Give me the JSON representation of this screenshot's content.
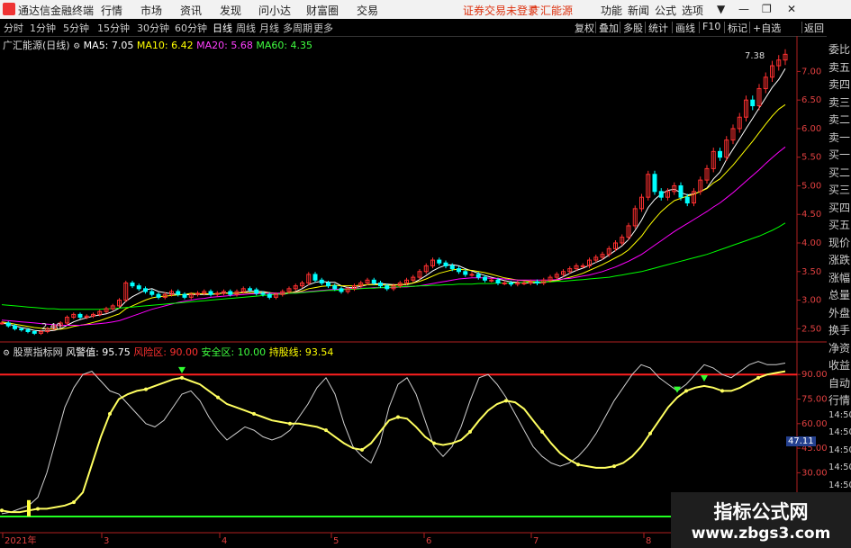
{
  "app": {
    "title": "通达信金融终端",
    "menu": [
      "行情",
      "市场",
      "资讯",
      "发现",
      "问小达",
      "财富圈",
      "交易"
    ],
    "notice": "证券交易未登录",
    "stock_name": "广汇能源",
    "right_menu": [
      "功能",
      "新闻",
      "公式",
      "选项"
    ],
    "window_controls": [
      "▼",
      "—",
      "❐",
      "✕"
    ]
  },
  "periods": {
    "items": [
      "分时",
      "1分钟",
      "5分钟",
      "15分钟",
      "30分钟",
      "60分钟",
      "日线",
      "周线",
      "月线",
      "多周期",
      "更多"
    ],
    "selected": "日线",
    "right_buttons": [
      "复权",
      "叠加",
      "多股",
      "统计",
      "画线",
      "F10",
      "标记",
      "+自选",
      "返回"
    ]
  },
  "main_legend": {
    "name": "广汇能源(日线)",
    "ma5": "MA5: 7.05",
    "ma10": "MA10: 6.42",
    "ma20": "MA20: 5.68",
    "ma60": "MA60: 4.35"
  },
  "indicator_legend": {
    "name": "股票指标网",
    "risk_value": "风警值: 95.75",
    "risk_zone": "风险区: 90.00",
    "safe_zone": "安全区: 10.00",
    "hold_line": "持股线: 93.54"
  },
  "price_axis": [
    "7.00",
    "6.50",
    "6.00",
    "5.50",
    "5.00",
    "4.50",
    "4.00",
    "3.50",
    "3.00",
    "2.50"
  ],
  "indicator_axis": [
    "90.00",
    "75.00",
    "60.00",
    "45.00",
    "30.00"
  ],
  "indicator_current": "47.11",
  "price_annotations": {
    "high": "7.38",
    "low": "2.40"
  },
  "x_axis": [
    "2021年",
    "3",
    "4",
    "5",
    "6",
    "7",
    "8"
  ],
  "right_panel": [
    "委比",
    "卖五",
    "卖四",
    "卖三",
    "卖二",
    "卖一",
    "买一",
    "买二",
    "买三",
    "买四",
    "买五",
    "现价",
    "涨跌",
    "涨幅",
    "总量",
    "外盘",
    "换手",
    "净资",
    "收益",
    "自动",
    "行情",
    "14:50",
    "14:50",
    "14:50",
    "14:50",
    "14:50",
    "14:50",
    "14:50",
    "14:50"
  ],
  "colors": {
    "ma5": "#ffffff",
    "ma10": "#ffff00",
    "ma20": "#ff00ff",
    "ma60": "#00ff00",
    "up": "#ff3030",
    "down": "#00ffff",
    "axis": "#e04040"
  },
  "watermark": {
    "title": "指标公式网",
    "url": "www.zbgs3.com"
  },
  "chart_data": {
    "type": "line",
    "title": "广汇能源(日线)",
    "xlabel": "",
    "ylabel": "",
    "ylim": [
      2.3,
      7.4
    ],
    "x": [
      "2021-01",
      "2021-02",
      "2021-03",
      "2021-04",
      "2021-05",
      "2021-06",
      "2021-07",
      "2021-08"
    ],
    "closes": [
      2.6,
      2.55,
      2.5,
      2.48,
      2.45,
      2.42,
      2.45,
      2.5,
      2.55,
      2.6,
      2.7,
      2.75,
      2.7,
      2.72,
      2.75,
      2.8,
      2.85,
      2.9,
      3.0,
      3.3,
      3.25,
      3.2,
      3.15,
      3.1,
      3.05,
      3.1,
      3.15,
      3.1,
      3.05,
      3.1,
      3.12,
      3.15,
      3.1,
      3.12,
      3.15,
      3.1,
      3.15,
      3.2,
      3.18,
      3.12,
      3.1,
      3.05,
      3.1,
      3.15,
      3.2,
      3.25,
      3.3,
      3.45,
      3.35,
      3.3,
      3.25,
      3.2,
      3.15,
      3.2,
      3.25,
      3.3,
      3.35,
      3.3,
      3.25,
      3.2,
      3.25,
      3.3,
      3.35,
      3.4,
      3.5,
      3.6,
      3.7,
      3.65,
      3.6,
      3.55,
      3.5,
      3.45,
      3.45,
      3.4,
      3.35,
      3.35,
      3.3,
      3.3,
      3.28,
      3.3,
      3.3,
      3.32,
      3.3,
      3.35,
      3.4,
      3.45,
      3.5,
      3.55,
      3.6,
      3.6,
      3.7,
      3.75,
      3.8,
      3.9,
      4.0,
      4.1,
      4.3,
      4.6,
      4.8,
      5.2,
      4.9,
      4.8,
      4.9,
      5.0,
      4.8,
      4.7,
      4.9,
      5.1,
      5.3,
      5.6,
      5.5,
      5.8,
      6.0,
      6.2,
      6.5,
      6.4,
      6.7,
      6.9,
      7.1,
      7.2,
      7.3
    ],
    "series": [
      {
        "name": "MA5",
        "values": [
          2.6,
          2.58,
          2.55,
          2.52,
          2.5,
          2.47,
          2.46,
          2.46,
          2.47,
          2.5,
          2.56,
          2.62,
          2.66,
          2.69,
          2.72,
          2.74,
          2.76,
          2.8,
          2.86,
          2.98,
          3.06,
          3.12,
          3.18,
          3.2,
          3.15,
          3.13,
          3.11,
          3.1,
          3.09,
          3.1,
          3.1,
          3.1,
          3.1,
          3.11,
          3.13,
          3.12,
          3.12,
          3.14,
          3.16,
          3.15,
          3.15,
          3.13,
          3.11,
          3.1,
          3.12,
          3.15,
          3.2,
          3.27,
          3.31,
          3.33,
          3.31,
          3.31,
          3.25,
          3.22,
          3.22,
          3.24,
          3.27,
          3.28,
          3.29,
          3.28,
          3.27,
          3.27,
          3.27,
          3.3,
          3.36,
          3.43,
          3.51,
          3.57,
          3.61,
          3.62,
          3.6,
          3.55,
          3.51,
          3.47,
          3.43,
          3.4,
          3.37,
          3.34,
          3.32,
          3.31,
          3.3,
          3.3,
          3.3,
          3.31,
          3.33,
          3.36,
          3.41,
          3.47,
          3.52,
          3.56,
          3.61,
          3.66,
          3.71,
          3.79,
          3.87,
          3.95,
          4.06,
          4.22,
          4.4,
          4.62,
          4.76,
          4.86,
          4.92,
          4.94,
          4.88,
          4.84,
          4.86,
          4.9,
          4.96,
          5.12,
          5.24,
          5.46,
          5.64,
          5.82,
          6.0,
          6.18,
          6.36,
          6.54,
          6.72,
          6.86,
          7.05
        ]
      },
      {
        "name": "MA10",
        "values": [
          2.62,
          2.6,
          2.58,
          2.56,
          2.54,
          2.52,
          2.51,
          2.5,
          2.49,
          2.49,
          2.51,
          2.54,
          2.56,
          2.58,
          2.61,
          2.64,
          2.68,
          2.72,
          2.76,
          2.85,
          2.9,
          2.95,
          3.0,
          3.04,
          3.06,
          3.07,
          3.08,
          3.09,
          3.1,
          3.12,
          3.11,
          3.11,
          3.11,
          3.11,
          3.12,
          3.12,
          3.12,
          3.13,
          3.13,
          3.13,
          3.13,
          3.13,
          3.12,
          3.12,
          3.13,
          3.14,
          3.16,
          3.2,
          3.22,
          3.24,
          3.25,
          3.26,
          3.25,
          3.25,
          3.25,
          3.26,
          3.27,
          3.27,
          3.27,
          3.26,
          3.26,
          3.27,
          3.28,
          3.3,
          3.33,
          3.37,
          3.42,
          3.47,
          3.5,
          3.53,
          3.54,
          3.53,
          3.52,
          3.5,
          3.48,
          3.45,
          3.42,
          3.39,
          3.37,
          3.35,
          3.34,
          3.33,
          3.32,
          3.32,
          3.33,
          3.34,
          3.37,
          3.4,
          3.43,
          3.47,
          3.52,
          3.57,
          3.62,
          3.68,
          3.74,
          3.8,
          3.88,
          4.0,
          4.12,
          4.28,
          4.42,
          4.55,
          4.65,
          4.74,
          4.78,
          4.82,
          4.85,
          4.9,
          4.95,
          5.05,
          5.12,
          5.24,
          5.36,
          5.5,
          5.64,
          5.78,
          5.93,
          6.08,
          6.22,
          6.34,
          6.42
        ]
      },
      {
        "name": "MA20",
        "values": [
          2.65,
          2.64,
          2.63,
          2.62,
          2.61,
          2.6,
          2.59,
          2.58,
          2.57,
          2.56,
          2.56,
          2.56,
          2.56,
          2.57,
          2.58,
          2.59,
          2.6,
          2.62,
          2.64,
          2.68,
          2.72,
          2.76,
          2.8,
          2.84,
          2.87,
          2.9,
          2.93,
          2.96,
          2.98,
          3.0,
          3.02,
          3.03,
          3.05,
          3.06,
          3.07,
          3.08,
          3.09,
          3.1,
          3.11,
          3.11,
          3.12,
          3.12,
          3.12,
          3.12,
          3.12,
          3.13,
          3.14,
          3.15,
          3.16,
          3.17,
          3.18,
          3.19,
          3.19,
          3.2,
          3.2,
          3.21,
          3.21,
          3.22,
          3.22,
          3.22,
          3.22,
          3.23,
          3.23,
          3.24,
          3.25,
          3.27,
          3.29,
          3.31,
          3.33,
          3.35,
          3.37,
          3.38,
          3.39,
          3.39,
          3.39,
          3.38,
          3.38,
          3.37,
          3.36,
          3.35,
          3.35,
          3.35,
          3.35,
          3.35,
          3.35,
          3.36,
          3.37,
          3.38,
          3.4,
          3.42,
          3.44,
          3.47,
          3.5,
          3.54,
          3.58,
          3.63,
          3.68,
          3.74,
          3.8,
          3.88,
          3.96,
          4.04,
          4.12,
          4.2,
          4.27,
          4.34,
          4.41,
          4.48,
          4.55,
          4.63,
          4.7,
          4.79,
          4.88,
          4.98,
          5.08,
          5.18,
          5.28,
          5.39,
          5.49,
          5.59,
          5.68
        ]
      },
      {
        "name": "MA60",
        "values": [
          2.92,
          2.91,
          2.9,
          2.89,
          2.88,
          2.87,
          2.86,
          2.85,
          2.85,
          2.84,
          2.84,
          2.84,
          2.84,
          2.84,
          2.84,
          2.84,
          2.85,
          2.85,
          2.86,
          2.87,
          2.88,
          2.89,
          2.9,
          2.91,
          2.92,
          2.93,
          2.94,
          2.95,
          2.96,
          2.97,
          2.98,
          2.99,
          3.0,
          3.01,
          3.02,
          3.03,
          3.04,
          3.05,
          3.06,
          3.07,
          3.08,
          3.09,
          3.1,
          3.11,
          3.12,
          3.12,
          3.13,
          3.14,
          3.15,
          3.16,
          3.17,
          3.17,
          3.18,
          3.19,
          3.19,
          3.2,
          3.21,
          3.21,
          3.22,
          3.22,
          3.23,
          3.23,
          3.24,
          3.24,
          3.25,
          3.25,
          3.26,
          3.26,
          3.27,
          3.27,
          3.28,
          3.28,
          3.28,
          3.29,
          3.29,
          3.29,
          3.3,
          3.3,
          3.3,
          3.3,
          3.31,
          3.31,
          3.31,
          3.32,
          3.32,
          3.33,
          3.33,
          3.34,
          3.35,
          3.36,
          3.37,
          3.38,
          3.39,
          3.4,
          3.42,
          3.44,
          3.46,
          3.48,
          3.5,
          3.53,
          3.56,
          3.59,
          3.62,
          3.65,
          3.68,
          3.71,
          3.74,
          3.77,
          3.8,
          3.84,
          3.88,
          3.92,
          3.96,
          4.0,
          4.04,
          4.08,
          4.12,
          4.17,
          4.22,
          4.28,
          4.35
        ]
      }
    ],
    "indicator": {
      "ylim": [
        0,
        100
      ],
      "risk_level": 90,
      "safe_level": 10,
      "slow": [
        7,
        6,
        6,
        7,
        8,
        8,
        9,
        10,
        12,
        18,
        35,
        52,
        66,
        75,
        78,
        80,
        81,
        83,
        85,
        87,
        88,
        86,
        84,
        80,
        76,
        72,
        70,
        68,
        66,
        64,
        62,
        61,
        60,
        60,
        59,
        58,
        56,
        52,
        48,
        45,
        44,
        48,
        55,
        62,
        64,
        63,
        58,
        52,
        48,
        47,
        48,
        50,
        55,
        62,
        68,
        72,
        74,
        73,
        69,
        62,
        55,
        48,
        42,
        38,
        35,
        34,
        33,
        33,
        34,
        36,
        40,
        46,
        54,
        62,
        70,
        76,
        80,
        82,
        83,
        82,
        80,
        80,
        82,
        85,
        88,
        90,
        91,
        92
      ],
      "fast": [
        5,
        6,
        8,
        10,
        15,
        30,
        50,
        70,
        82,
        90,
        92,
        86,
        80,
        78,
        72,
        66,
        60,
        58,
        62,
        70,
        78,
        80,
        74,
        64,
        56,
        50,
        54,
        58,
        56,
        52,
        50,
        52,
        56,
        64,
        72,
        82,
        88,
        78,
        60,
        46,
        40,
        36,
        48,
        70,
        84,
        88,
        78,
        62,
        46,
        40,
        46,
        58,
        74,
        88,
        90,
        84,
        76,
        66,
        56,
        46,
        40,
        36,
        34,
        36,
        40,
        46,
        54,
        64,
        74,
        82,
        90,
        96,
        94,
        88,
        84,
        80,
        84,
        90,
        96,
        94,
        90,
        88,
        92,
        96,
        98,
        96,
        96,
        97
      ]
    }
  }
}
